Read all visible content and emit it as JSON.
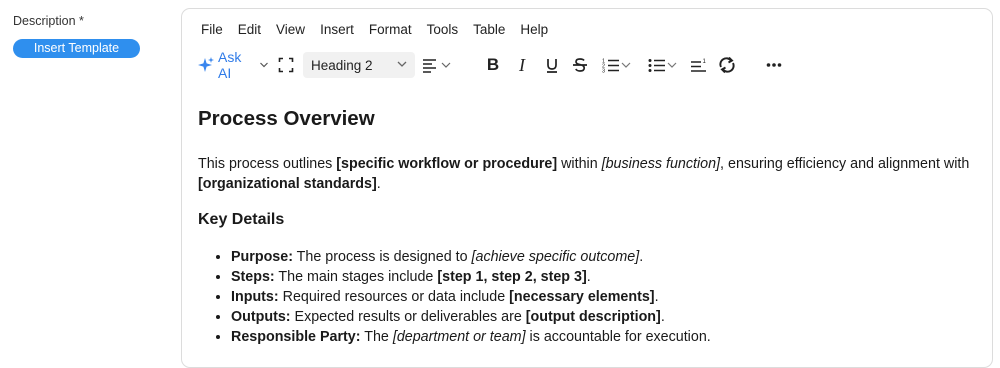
{
  "field": {
    "label": "Description *",
    "insert_template_label": "Insert Template"
  },
  "menubar": [
    "File",
    "Edit",
    "View",
    "Insert",
    "Format",
    "Tools",
    "Table",
    "Help"
  ],
  "toolbar": {
    "ask_ai_label": "Ask AI",
    "block_format_value": "Heading 2",
    "icons": [
      "sparkle-icon",
      "fullscreen-icon",
      "align-icon",
      "bold-icon",
      "italic-icon",
      "underline-icon",
      "strikethrough-icon",
      "numbered-list-icon",
      "bullet-list-icon",
      "line-height-icon",
      "redo-icon",
      "more-icon"
    ]
  },
  "document": {
    "title": "Process Overview",
    "intro": [
      {
        "t": "This process outlines ",
        "s": "n"
      },
      {
        "t": "[specific workflow or procedure]",
        "s": "b"
      },
      {
        "t": " within ",
        "s": "n"
      },
      {
        "t": "[business function]",
        "s": "i"
      },
      {
        "t": ", ensuring efficiency and alignment with ",
        "s": "n"
      },
      {
        "t": "[organizational standards]",
        "s": "b"
      },
      {
        "t": ".",
        "s": "n"
      }
    ],
    "section_heading": "Key Details",
    "items": [
      [
        {
          "t": "Purpose:",
          "s": "b"
        },
        {
          "t": " The process is designed to ",
          "s": "n"
        },
        {
          "t": "[achieve specific outcome]",
          "s": "i"
        },
        {
          "t": ".",
          "s": "n"
        }
      ],
      [
        {
          "t": "Steps:",
          "s": "b"
        },
        {
          "t": " The main stages include ",
          "s": "n"
        },
        {
          "t": "[step 1, step 2, step 3]",
          "s": "b"
        },
        {
          "t": ".",
          "s": "n"
        }
      ],
      [
        {
          "t": "Inputs:",
          "s": "b"
        },
        {
          "t": " Required resources or data include ",
          "s": "n"
        },
        {
          "t": "[necessary elements]",
          "s": "b"
        },
        {
          "t": ".",
          "s": "n"
        }
      ],
      [
        {
          "t": "Outputs:",
          "s": "b"
        },
        {
          "t": " Expected results or deliverables are ",
          "s": "n"
        },
        {
          "t": "[output description]",
          "s": "b"
        },
        {
          "t": ".",
          "s": "n"
        }
      ],
      [
        {
          "t": "Responsible Party:",
          "s": "b"
        },
        {
          "t": " The ",
          "s": "n"
        },
        {
          "t": "[department or team]",
          "s": "i"
        },
        {
          "t": " is accountable for execution.",
          "s": "n"
        }
      ]
    ]
  },
  "colors": {
    "accent": "#2f8fee",
    "ask_ai": "#2f7be8"
  }
}
